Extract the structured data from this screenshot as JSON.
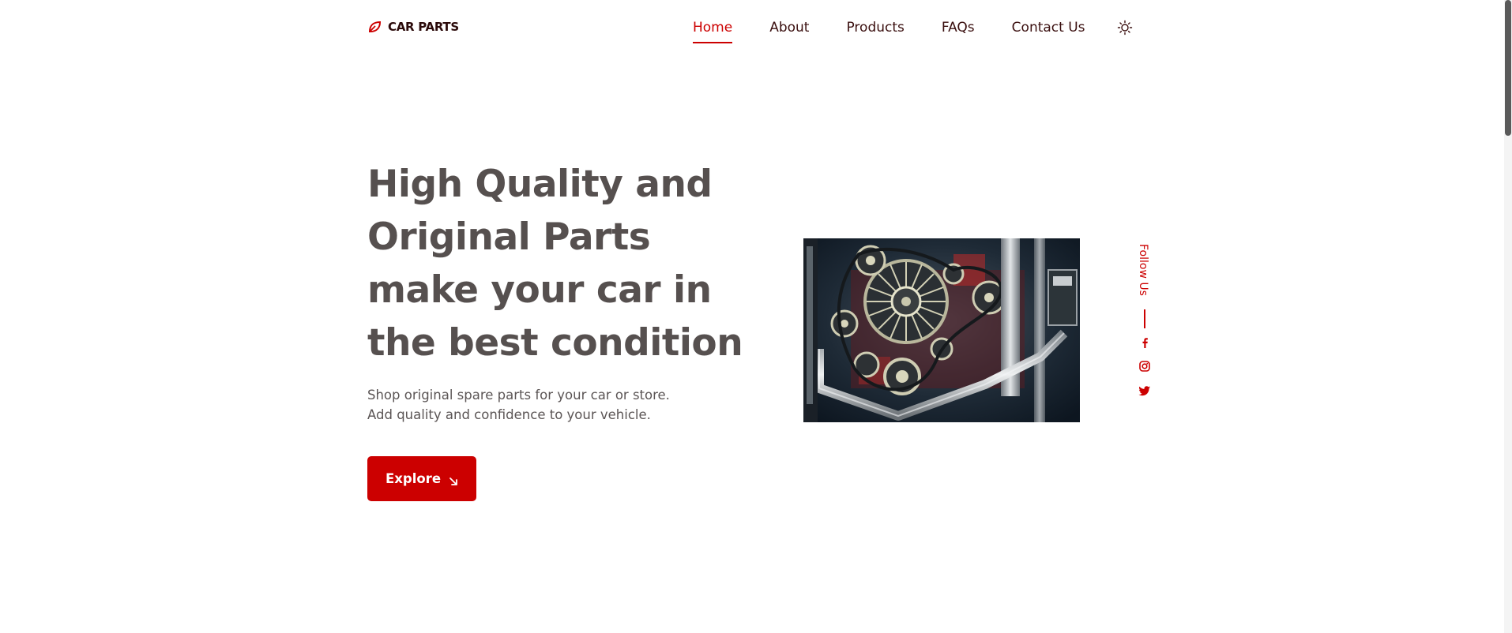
{
  "brand": {
    "name": "CAR PARTS",
    "accent_color": "#cc0000",
    "icon": "leaf-icon"
  },
  "nav": {
    "items": [
      {
        "label": "Home",
        "active": true
      },
      {
        "label": "About",
        "active": false
      },
      {
        "label": "Products",
        "active": false
      },
      {
        "label": "FAQs",
        "active": false
      },
      {
        "label": "Contact Us",
        "active": false
      }
    ],
    "theme_toggle_icon": "sun-icon"
  },
  "hero": {
    "title_lines": [
      "High Quality and",
      "Original Parts",
      "make your car in",
      "the best condition"
    ],
    "description_lines": [
      "Shop original spare parts for your car or store.",
      "Add quality and confidence to your vehicle."
    ],
    "button_label": "Explore",
    "button_icon": "arrow-down-right-icon",
    "image": "engine-image"
  },
  "social": {
    "follow_label": "Follow Us",
    "icons": [
      "facebook-icon",
      "instagram-icon",
      "twitter-icon"
    ]
  },
  "colors": {
    "heading": "#56504f",
    "text": "#5b5555",
    "nav_text": "#3a0f0f"
  }
}
